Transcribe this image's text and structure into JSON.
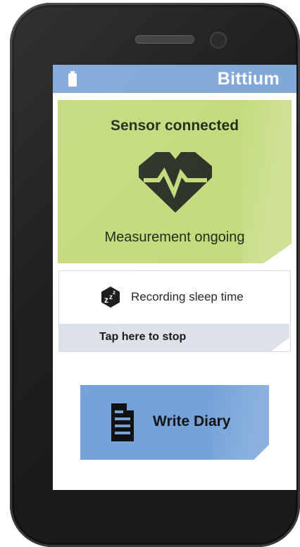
{
  "status_bar": {
    "brand": "Bittium",
    "battery_icon": "battery-icon"
  },
  "sensor_card": {
    "title": "Sensor connected",
    "icon": "heart-pulse-icon",
    "status": "Measurement ongoing"
  },
  "sleep_card": {
    "icon": "sleep-zzz-icon",
    "label": "Recording sleep time",
    "action": "Tap here to stop"
  },
  "diary_button": {
    "icon": "document-icon",
    "label": "Write Diary"
  },
  "colors": {
    "status_bar": "#7ea6d8",
    "sensor_card": "#c3db7c",
    "diary_button": "#75a3d9",
    "stop_bar": "#dde1e8"
  }
}
